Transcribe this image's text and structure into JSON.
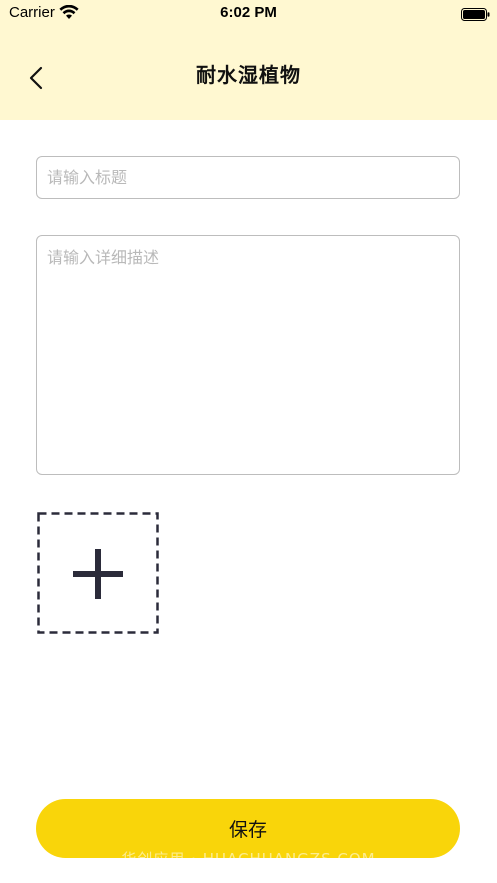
{
  "status_bar": {
    "carrier": "Carrier",
    "time": "6:02 PM",
    "wifi_icon": "wifi-icon",
    "battery_icon": "battery-full-icon"
  },
  "header": {
    "title": "耐水湿植物",
    "back_icon": "chevron-left-icon",
    "background_color": "#fff8d1"
  },
  "form": {
    "title_placeholder": "请输入标题",
    "title_value": "",
    "description_placeholder": "请输入详细描述",
    "description_value": "",
    "add_photo_icon": "plus-icon"
  },
  "actions": {
    "save_label": "保存",
    "save_color": "#f9d50a"
  },
  "watermark": "华创应用 · HUACHUANGZS.COM"
}
